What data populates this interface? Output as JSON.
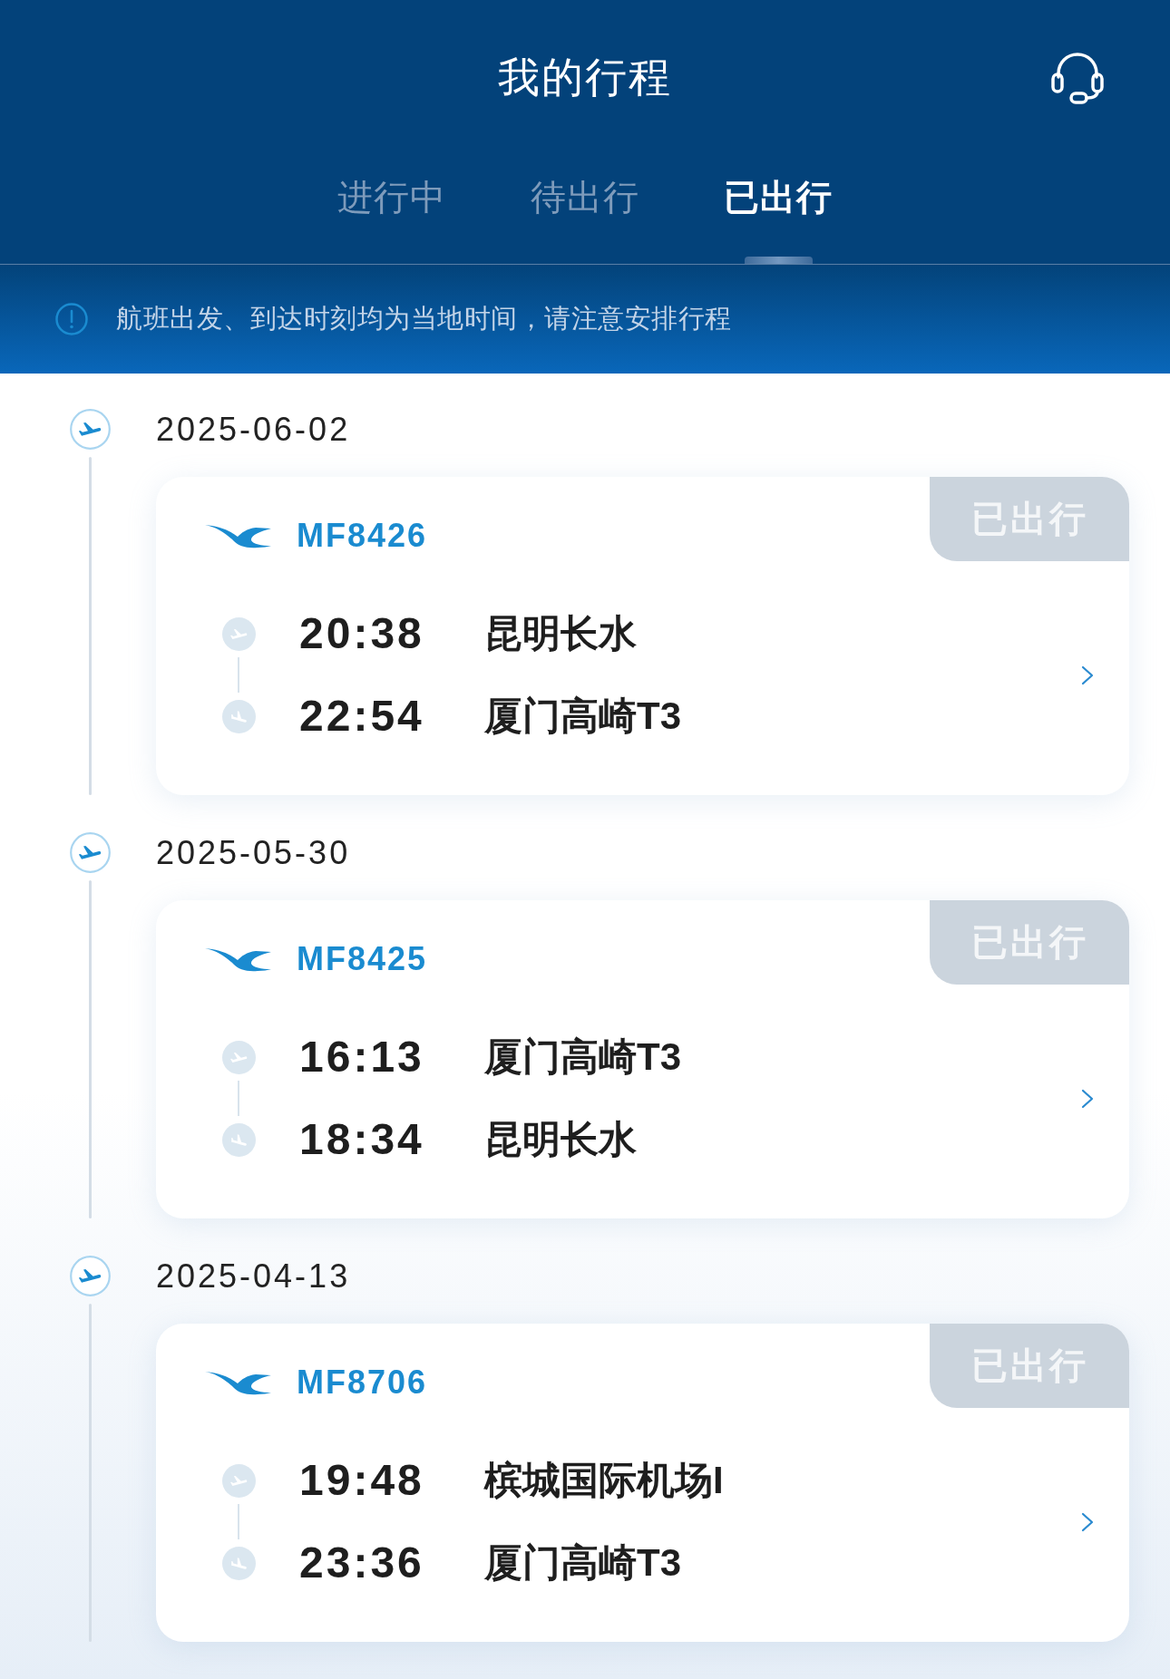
{
  "header": {
    "title": "我的行程"
  },
  "tabs": [
    {
      "label": "进行中",
      "selected": false
    },
    {
      "label": "待出行",
      "selected": false
    },
    {
      "label": "已出行",
      "selected": true
    }
  ],
  "notice": {
    "text": "航班出发、到达时刻均为当地时间，请注意安排行程"
  },
  "trips": [
    {
      "date": "2025-06-02",
      "flight": "MF8426",
      "status": "已出行",
      "legs": [
        {
          "kind": "departure",
          "time": "20:38",
          "airport": "昆明长水"
        },
        {
          "kind": "arrival",
          "time": "22:54",
          "airport": "厦门高崎T3"
        }
      ]
    },
    {
      "date": "2025-05-30",
      "flight": "MF8425",
      "status": "已出行",
      "legs": [
        {
          "kind": "departure",
          "time": "16:13",
          "airport": "厦门高崎T3"
        },
        {
          "kind": "arrival",
          "time": "18:34",
          "airport": "昆明长水"
        }
      ]
    },
    {
      "date": "2025-04-13",
      "flight": "MF8706",
      "status": "已出行",
      "legs": [
        {
          "kind": "departure",
          "time": "19:48",
          "airport": "槟城国际机场I"
        },
        {
          "kind": "arrival",
          "time": "23:36",
          "airport": "厦门高崎T3"
        }
      ]
    }
  ]
}
